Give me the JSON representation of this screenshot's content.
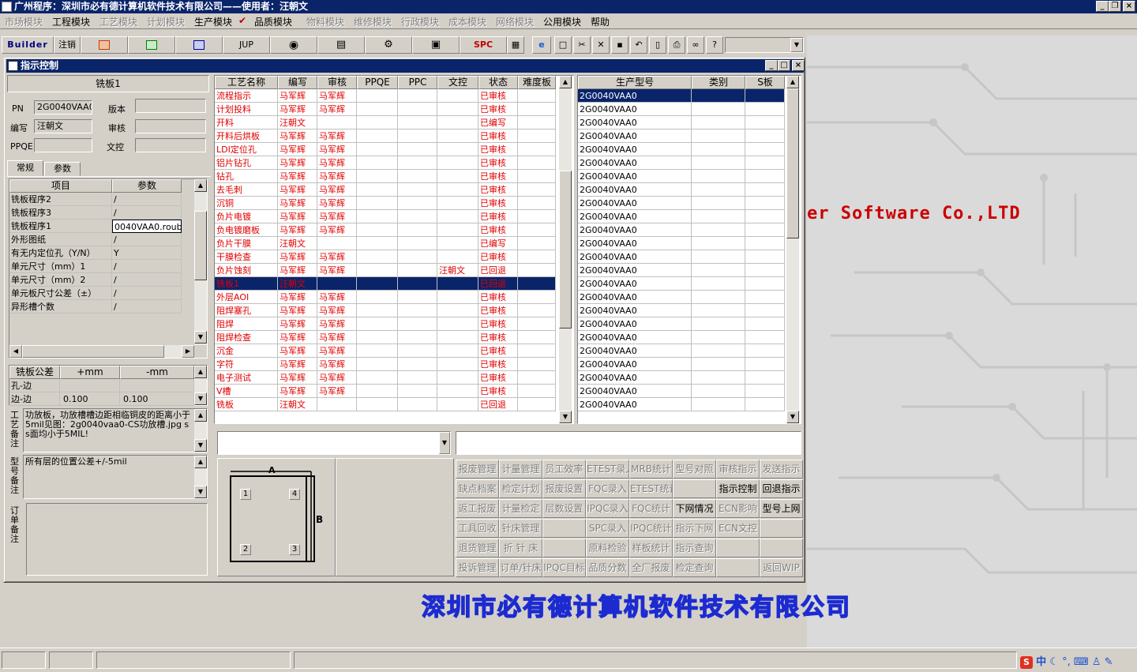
{
  "app": {
    "title": "广州程序：深圳市必有德计算机软件技术有限公司——使用者：汪朝文"
  },
  "menu": [
    {
      "label": "市场模块",
      "enabled": false
    },
    {
      "label": "工程模块",
      "enabled": true
    },
    {
      "label": "工艺模块",
      "enabled": false
    },
    {
      "label": "计划模块",
      "enabled": false
    },
    {
      "label": "生产模块",
      "enabled": true
    },
    {
      "label": "品质模块",
      "enabled": true
    },
    {
      "label": "物料模块",
      "enabled": false
    },
    {
      "label": "维修模块",
      "enabled": false
    },
    {
      "label": "行政模块",
      "enabled": false
    },
    {
      "label": "成本模块",
      "enabled": false
    },
    {
      "label": "网络模块",
      "enabled": false
    },
    {
      "label": "公用模块",
      "enabled": true
    },
    {
      "label": "帮助",
      "enabled": true
    }
  ],
  "toolbar": {
    "builder": "Builder",
    "logout": "注销",
    "jup": "JUP",
    "spc": "SPC"
  },
  "window": {
    "title": "指示控制",
    "minimize": "_",
    "maximize": "□",
    "close": "×"
  },
  "left": {
    "panel_title": "铣板1",
    "pn_label": "PN",
    "pn_value": "2G0040VAA0",
    "version_label": "版本",
    "version_value": "",
    "author_label": "编写",
    "author_value": "汪朝文",
    "review_label": "审核",
    "review_value": "",
    "ppqe_label": "PPQE",
    "ppqe_value": "",
    "control_label": "文控",
    "control_value": "",
    "tabs": [
      "常规",
      "参数"
    ],
    "param_headers": [
      "项目",
      "参数"
    ],
    "params": [
      [
        "铣板程序2",
        "/"
      ],
      [
        "铣板程序3",
        "/"
      ],
      [
        "铣板程序1",
        "0040VAA0.roubk"
      ],
      [
        "外形图纸",
        "/"
      ],
      [
        "有无内定位孔（Y/N）",
        "Y"
      ],
      [
        "单元尺寸（mm）1",
        "/"
      ],
      [
        "单元尺寸（mm）2",
        "/"
      ],
      [
        "单元板尺寸公差（±）",
        "/"
      ],
      [
        "异形槽个数",
        "/"
      ]
    ],
    "tol_headers": [
      "铣板公差",
      "+mm",
      "-mm"
    ],
    "tolerances": [
      [
        "孔-边",
        "",
        ""
      ],
      [
        "边-边",
        "0.100",
        "0.100"
      ]
    ],
    "process_note_label": "工艺备注",
    "process_note": "功放板，功放槽槽边距相临铜皮的距离小于5mil见图：2g0040vaa0-CS功放槽.jpg ss面均小于5MIL!",
    "model_note_label": "型号备注",
    "model_note": "所有层的位置公差+/-5mil",
    "order_note_label": "订单备注",
    "order_note": ""
  },
  "process_table": {
    "headers": [
      "工艺名称",
      "编写",
      "审核",
      "PPQE",
      "PPC",
      "文控",
      "状态",
      "难度板"
    ],
    "rows": [
      [
        "流程指示",
        "马军辉",
        "马军辉",
        "",
        "",
        "",
        "已审核"
      ],
      [
        "计划投料",
        "马军辉",
        "马军辉",
        "",
        "",
        "",
        "已审核"
      ],
      [
        "开料",
        "汪朝文",
        "",
        "",
        "",
        "",
        "已编写"
      ],
      [
        "开料后烘板",
        "马军辉",
        "马军辉",
        "",
        "",
        "",
        "已审核"
      ],
      [
        "LDI定位孔",
        "马军辉",
        "马军辉",
        "",
        "",
        "",
        "已审核"
      ],
      [
        "铝片钻孔",
        "马军辉",
        "马军辉",
        "",
        "",
        "",
        "已审核"
      ],
      [
        "钻孔",
        "马军辉",
        "马军辉",
        "",
        "",
        "",
        "已审核"
      ],
      [
        "去毛刺",
        "马军辉",
        "马军辉",
        "",
        "",
        "",
        "已审核"
      ],
      [
        "沉铜",
        "马军辉",
        "马军辉",
        "",
        "",
        "",
        "已审核"
      ],
      [
        "负片电镀",
        "马军辉",
        "马军辉",
        "",
        "",
        "",
        "已审核"
      ],
      [
        "负电镀磨板",
        "马军辉",
        "马军辉",
        "",
        "",
        "",
        "已审核"
      ],
      [
        "负片干膜",
        "汪朝文",
        "",
        "",
        "",
        "",
        "已编写"
      ],
      [
        "干膜检查",
        "马军辉",
        "马军辉",
        "",
        "",
        "",
        "已审核"
      ],
      [
        "负片蚀刻",
        "马军辉",
        "马军辉",
        "",
        "",
        "汪朝文",
        "已回退"
      ],
      [
        "铣板1",
        "汪朝文",
        "",
        "",
        "",
        "",
        "已回退"
      ],
      [
        "外层AOI",
        "马军辉",
        "马军辉",
        "",
        "",
        "",
        "已审核"
      ],
      [
        "阻焊塞孔",
        "马军辉",
        "马军辉",
        "",
        "",
        "",
        "已审核"
      ],
      [
        "阻焊",
        "马军辉",
        "马军辉",
        "",
        "",
        "",
        "已审核"
      ],
      [
        "阻焊检查",
        "马军辉",
        "马军辉",
        "",
        "",
        "",
        "已审核"
      ],
      [
        "沉金",
        "马军辉",
        "马军辉",
        "",
        "",
        "",
        "已审核"
      ],
      [
        "字符",
        "马军辉",
        "马军辉",
        "",
        "",
        "",
        "已审核"
      ],
      [
        "电子测试",
        "马军辉",
        "马军辉",
        "",
        "",
        "",
        "已审核"
      ],
      [
        "V槽",
        "马军辉",
        "马军辉",
        "",
        "",
        "",
        "已审核"
      ],
      [
        "铣板",
        "汪朝文",
        "",
        "",
        "",
        "",
        "已回退"
      ]
    ]
  },
  "model_table": {
    "headers": [
      "生产型号",
      "类别",
      "S板"
    ],
    "rows": [
      "2G0040VAA0",
      "2G0040VAA0",
      "2G0040VAA0",
      "2G0040VAA0",
      "2G0040VAA0",
      "2G0040VAA0",
      "2G0040VAA0",
      "2G0040VAA0",
      "2G0040VAA0",
      "2G0040VAA0",
      "2G0040VAA0",
      "2G0040VAA0",
      "2G0040VAA0",
      "2G0040VAA0",
      "2G0040VAA0",
      "2G0040VAA0",
      "2G0040VAA0",
      "2G0040VAA0",
      "2G0040VAA0",
      "2G0040VAA0",
      "2G0040VAA0",
      "2G0040VAA0",
      "2G0040VAA0",
      "2G0040VAA0"
    ]
  },
  "diagram": {
    "a": "A",
    "b": "B",
    "holes": [
      "1",
      "4",
      "2",
      "3"
    ]
  },
  "buttons": [
    [
      {
        "t": "报废管理",
        "e": false
      },
      {
        "t": "计量管理",
        "e": false
      },
      {
        "t": "员工效率",
        "e": false
      },
      {
        "t": "ETEST录入",
        "e": false
      },
      {
        "t": "MRB统计",
        "e": false
      },
      {
        "t": "型号对照",
        "e": false
      },
      {
        "t": "审核指示",
        "e": false
      },
      {
        "t": "发送指示",
        "e": false
      }
    ],
    [
      {
        "t": "缺点档案",
        "e": false
      },
      {
        "t": "检定计划",
        "e": false
      },
      {
        "t": "报废设置",
        "e": false
      },
      {
        "t": "FQC录入",
        "e": false
      },
      {
        "t": "ETEST统计",
        "e": false
      },
      {
        "t": "",
        "e": false
      },
      {
        "t": "指示控制",
        "e": true
      },
      {
        "t": "回退指示",
        "e": true
      }
    ],
    [
      {
        "t": "返工报废",
        "e": false
      },
      {
        "t": "计量检定",
        "e": false
      },
      {
        "t": "层数设置",
        "e": false
      },
      {
        "t": "IPQC录入",
        "e": false
      },
      {
        "t": "FQC统计",
        "e": false
      },
      {
        "t": "下网情况",
        "e": true
      },
      {
        "t": "ECN影响",
        "e": false
      },
      {
        "t": "型号上网",
        "e": true
      }
    ],
    [
      {
        "t": "工具回收",
        "e": false
      },
      {
        "t": "针床管理",
        "e": false
      },
      {
        "t": "",
        "e": false
      },
      {
        "t": "SPC录入",
        "e": false
      },
      {
        "t": "IPQC统计",
        "e": false
      },
      {
        "t": "指示下网",
        "e": false
      },
      {
        "t": "ECN文控",
        "e": false
      },
      {
        "t": "",
        "e": false
      }
    ],
    [
      {
        "t": "退货管理",
        "e": false
      },
      {
        "t": "折 针 床",
        "e": false
      },
      {
        "t": "",
        "e": false
      },
      {
        "t": "原料检验",
        "e": false
      },
      {
        "t": "样板统计",
        "e": false
      },
      {
        "t": "指示查询",
        "e": false
      },
      {
        "t": "",
        "e": false
      },
      {
        "t": "",
        "e": false
      }
    ],
    [
      {
        "t": "投诉管理",
        "e": false
      },
      {
        "t": "订单/针床",
        "e": false
      },
      {
        "t": "IPQC目标",
        "e": false
      },
      {
        "t": "品质分数",
        "e": false
      },
      {
        "t": "全厂报废",
        "e": false
      },
      {
        "t": "检定查询",
        "e": false
      },
      {
        "t": "",
        "e": false
      },
      {
        "t": "返回WIP",
        "e": false
      }
    ]
  ],
  "desktop": {
    "software_text": "er Software Co.,LTD",
    "company": "深圳市必有德计算机软件技术有限公司"
  },
  "tray": {
    "ime": "中"
  }
}
